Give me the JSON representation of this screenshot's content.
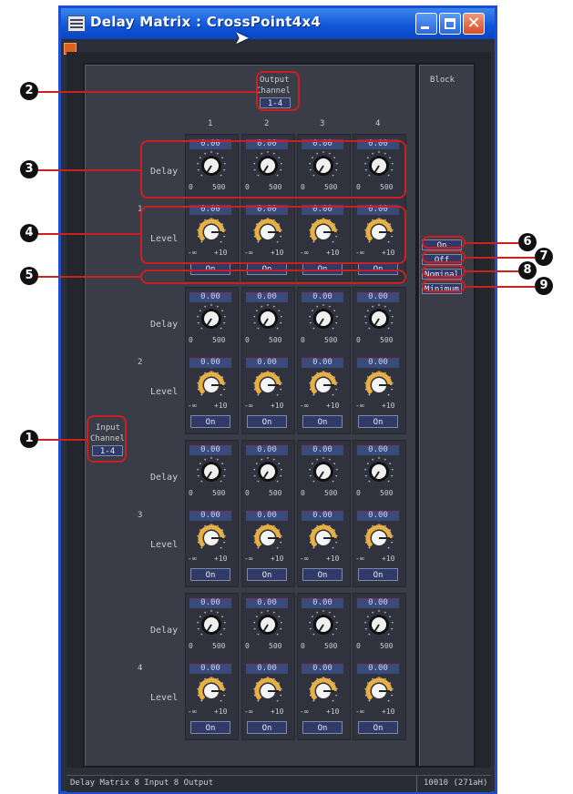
{
  "window": {
    "title": "Delay Matrix : CrossPoint4x4",
    "status_left": "Delay Matrix   8 Input 8 Output",
    "status_right": "10010 (271aH)"
  },
  "output": {
    "heading_line1": "Output",
    "heading_line2": "Channel",
    "range_button": "1-4",
    "columns": [
      "1",
      "2",
      "3",
      "4"
    ]
  },
  "input": {
    "heading_line1": "Input",
    "heading_line2": "Channel",
    "range_button": "1-4",
    "rows": [
      "1",
      "2",
      "3",
      "4"
    ]
  },
  "block": {
    "heading": "Block",
    "on": "On",
    "off": "Off",
    "nominal": "Nominal",
    "minimum": "Minimum"
  },
  "labels": {
    "delay": "Delay",
    "level": "Level",
    "delay_min": "0",
    "delay_max": "500",
    "level_min": "-∞",
    "level_max": "+10",
    "on_button": "On"
  },
  "cells": [
    [
      {
        "delay": "0.00",
        "level": "0.00"
      },
      {
        "delay": "0.00",
        "level": "0.00"
      },
      {
        "delay": "0.00",
        "level": "0.00"
      },
      {
        "delay": "0.00",
        "level": "0.00"
      }
    ],
    [
      {
        "delay": "0.00",
        "level": "0.00"
      },
      {
        "delay": "0.00",
        "level": "0.00"
      },
      {
        "delay": "0.00",
        "level": "0.00"
      },
      {
        "delay": "0.00",
        "level": "0.00"
      }
    ],
    [
      {
        "delay": "0.00",
        "level": "0.00"
      },
      {
        "delay": "0.00",
        "level": "0.00"
      },
      {
        "delay": "0.00",
        "level": "0.00"
      },
      {
        "delay": "0.00",
        "level": "0.00"
      }
    ],
    [
      {
        "delay": "0.00",
        "level": "0.00"
      },
      {
        "delay": "0.00",
        "level": "0.00"
      },
      {
        "delay": "0.00",
        "level": "0.00"
      },
      {
        "delay": "0.00",
        "level": "0.00"
      }
    ]
  ],
  "callouts": [
    "1",
    "2",
    "3",
    "4",
    "5",
    "6",
    "7",
    "8",
    "9"
  ],
  "colors": {
    "title_bar": "#0d55d8",
    "callout": "#cc2020",
    "level_knob": "#e8b040",
    "delay_knob": "#f0f0f0",
    "field": "#3a4a7a"
  }
}
